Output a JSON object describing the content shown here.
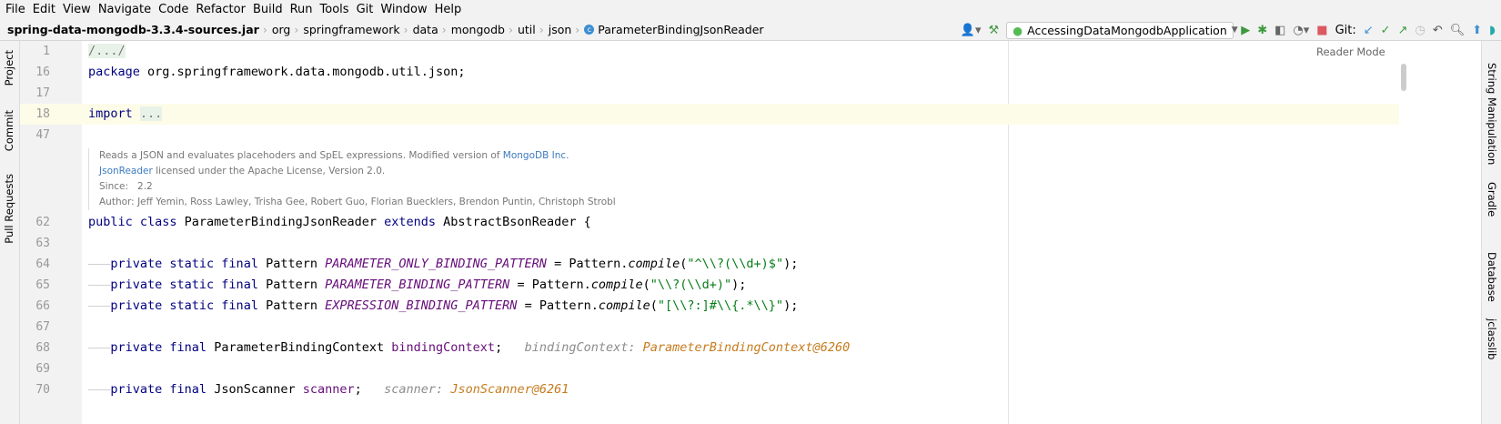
{
  "menu": [
    "File",
    "Edit",
    "View",
    "Navigate",
    "Code",
    "Refactor",
    "Build",
    "Run",
    "Tools",
    "Git",
    "Window",
    "Help"
  ],
  "breadcrumb": [
    "spring-data-mongodb-3.3.4-sources.jar",
    "org",
    "springframework",
    "data",
    "mongodb",
    "util",
    "json",
    "ParameterBindingJsonReader"
  ],
  "toolbar": {
    "run_config": "AccessingDataMongodbApplication",
    "git_label": "Git:"
  },
  "left_tabs": [
    "Project",
    "Commit",
    "Pull Requests"
  ],
  "right_tabs": [
    "String Manipulation",
    "Gradle",
    "Database",
    "jclasslib"
  ],
  "reader_mode": "Reader Mode",
  "doc": {
    "line1": "Reads a JSON and evaluates placehoders and SpEL expressions. Modified version of ",
    "link1": "MongoDB Inc.",
    "link2": "JsonReader",
    "line2": " licensed under the Apache License, Version 2.0.",
    "since_label": "Since:",
    "since": "2.2",
    "author_label": "Author:",
    "author": "Jeff Yemin, Ross Lawley, Trisha Gee, Robert Guo, Florian Buecklers, Brendon Puntin, Christoph Strobl"
  },
  "lines": [
    {
      "n": "1",
      "t": [
        [
          "fold",
          "/.../"
        ]
      ]
    },
    {
      "n": "16",
      "t": [
        [
          "kw",
          "package "
        ],
        [
          "",
          "org.springframework.data.mongodb.util.json;"
        ]
      ]
    },
    {
      "n": "17",
      "t": []
    },
    {
      "n": "18",
      "hl": true,
      "t": [
        [
          "kw",
          "import "
        ],
        [
          "fold",
          "..."
        ]
      ]
    },
    {
      "n": "47",
      "t": []
    },
    {
      "n": "62",
      "t": [
        [
          "kw",
          "public class "
        ],
        [
          "",
          "ParameterBindingJsonReader "
        ],
        [
          "kw",
          "extends "
        ],
        [
          "",
          "AbstractBsonReader {"
        ]
      ]
    },
    {
      "n": "63",
      "t": []
    },
    {
      "n": "64",
      "t": [
        [
          "ws",
          "———"
        ],
        [
          "kw",
          "private static final "
        ],
        [
          "",
          "Pattern "
        ],
        [
          "const",
          "PARAMETER_ONLY_BINDING_PATTERN"
        ],
        [
          "",
          " = Pattern."
        ],
        [
          "fn",
          "compile"
        ],
        [
          "",
          "("
        ],
        [
          "str",
          "\"^\\\\?(\\\\d+)$\""
        ],
        [
          "",
          ");"
        ]
      ]
    },
    {
      "n": "65",
      "t": [
        [
          "ws",
          "———"
        ],
        [
          "kw",
          "private static final "
        ],
        [
          "",
          "Pattern "
        ],
        [
          "const",
          "PARAMETER_BINDING_PATTERN"
        ],
        [
          "",
          " = Pattern."
        ],
        [
          "fn",
          "compile"
        ],
        [
          "",
          "("
        ],
        [
          "str",
          "\"\\\\?(\\\\d+)\""
        ],
        [
          "",
          ");"
        ]
      ]
    },
    {
      "n": "66",
      "t": [
        [
          "ws",
          "———"
        ],
        [
          "kw",
          "private static final "
        ],
        [
          "",
          "Pattern "
        ],
        [
          "const",
          "EXPRESSION_BINDING_PATTERN"
        ],
        [
          "",
          " = Pattern."
        ],
        [
          "fn",
          "compile"
        ],
        [
          "",
          "("
        ],
        [
          "str",
          "\"[\\\\?:]#\\\\{.*\\\\}\""
        ],
        [
          "",
          ");"
        ]
      ]
    },
    {
      "n": "67",
      "t": []
    },
    {
      "n": "68",
      "t": [
        [
          "ws",
          "———"
        ],
        [
          "kw",
          "private final "
        ],
        [
          "",
          "ParameterBindingContext "
        ],
        [
          "field",
          "bindingContext"
        ],
        [
          "",
          ";   "
        ],
        [
          "dbgk",
          "bindingContext: "
        ],
        [
          "dbgv",
          "ParameterBindingContext@6260"
        ]
      ]
    },
    {
      "n": "69",
      "t": []
    },
    {
      "n": "70",
      "t": [
        [
          "ws",
          "———"
        ],
        [
          "kw",
          "private final "
        ],
        [
          "",
          "JsonScanner "
        ],
        [
          "field",
          "scanner"
        ],
        [
          "",
          ";   "
        ],
        [
          "dbgk",
          "scanner: "
        ],
        [
          "dbgv",
          "JsonScanner@6261"
        ]
      ]
    }
  ]
}
